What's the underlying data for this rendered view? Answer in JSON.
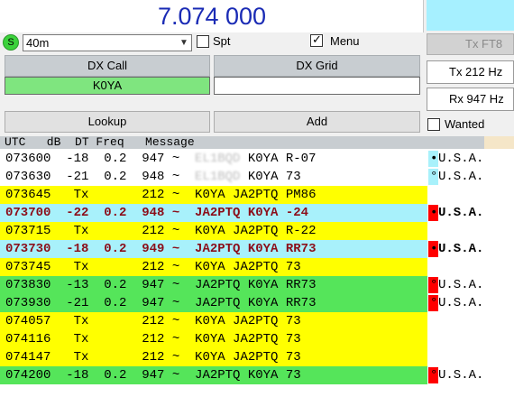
{
  "frequency": "7.074 000",
  "colors": {
    "cq_row": "#ffffff",
    "tx_row": "#ffff00",
    "to_me_row": "#ff0000",
    "reply_row": "#a8f1fb",
    "new_country_row": "#55e55a",
    "dx_call_field": "#7fe57f",
    "frequency_text": "#1a2bb5"
  },
  "controls": {
    "s_button": "S",
    "band": "40m",
    "spt_label": "Spt",
    "spt_checked": false,
    "menu_label": "Menu",
    "menu_checked": true,
    "tx_mode_button": "Tx FT8"
  },
  "dx": {
    "call_header": "DX Call",
    "call_value": "K0YA",
    "grid_header": "DX Grid",
    "grid_value": "",
    "lookup_label": "Lookup",
    "add_label": "Add"
  },
  "tx_rx": {
    "tx_text": "Tx  212  Hz",
    "rx_text": "Rx  947  Hz",
    "wanted_label": "Wanted",
    "wanted_checked": false
  },
  "columns_header": "UTC   dB  DT Freq   Message",
  "messages": [
    {
      "utc": "073600",
      "db": "-18",
      "dt": "0.2",
      "freq": "947",
      "sep": "~",
      "call_from": "EL1BQD",
      "call_from_blurred": true,
      "text": "K0YA R-07",
      "bg": "#ffffff",
      "bold": false,
      "mark_color": "#a8f1fb",
      "mark_symbol": "•",
      "country": "U.S.A."
    },
    {
      "utc": "073630",
      "db": "-21",
      "dt": "0.2",
      "freq": "948",
      "sep": "~",
      "call_from": "EL1BQD",
      "call_from_blurred": true,
      "text": "K0YA 73",
      "bg": "#ffffff",
      "bold": false,
      "mark_color": "#a8f1fb",
      "mark_symbol": "°",
      "country": "U.S.A."
    },
    {
      "utc": "073645",
      "db": "Tx",
      "dt": "",
      "freq": "212",
      "sep": "~",
      "call_from": "",
      "call_from_blurred": false,
      "text": "K0YA JA2PTQ PM86",
      "bg": "#ffff00",
      "bold": false,
      "mark_color": "",
      "mark_symbol": "",
      "country": ""
    },
    {
      "utc": "073700",
      "db": "-22",
      "dt": "0.2",
      "freq": "948",
      "sep": "~",
      "call_from": "",
      "call_from_blurred": false,
      "text": "JA2PTQ K0YA -24",
      "bg": "#a8f1fb",
      "bold": true,
      "mark_color": "#ff0000",
      "mark_symbol": "•",
      "country": "U.S.A."
    },
    {
      "utc": "073715",
      "db": "Tx",
      "dt": "",
      "freq": "212",
      "sep": "~",
      "call_from": "",
      "call_from_blurred": false,
      "text": "K0YA JA2PTQ R-22",
      "bg": "#ffff00",
      "bold": false,
      "mark_color": "",
      "mark_symbol": "",
      "country": ""
    },
    {
      "utc": "073730",
      "db": "-18",
      "dt": "0.2",
      "freq": "949",
      "sep": "~",
      "call_from": "",
      "call_from_blurred": false,
      "text": "JA2PTQ K0YA RR73",
      "bg": "#a8f1fb",
      "bold": true,
      "mark_color": "#ff0000",
      "mark_symbol": "•",
      "country": "U.S.A."
    },
    {
      "utc": "073745",
      "db": "Tx",
      "dt": "",
      "freq": "212",
      "sep": "~",
      "call_from": "",
      "call_from_blurred": false,
      "text": "K0YA JA2PTQ 73",
      "bg": "#ffff00",
      "bold": false,
      "mark_color": "",
      "mark_symbol": "",
      "country": ""
    },
    {
      "utc": "073830",
      "db": "-13",
      "dt": "0.2",
      "freq": "947",
      "sep": "~",
      "call_from": "",
      "call_from_blurred": false,
      "text": "JA2PTQ K0YA RR73",
      "bg": "#55e55a",
      "bold": false,
      "mark_color": "#ff0000",
      "mark_symbol": "°",
      "country": "U.S.A."
    },
    {
      "utc": "073930",
      "db": "-21",
      "dt": "0.2",
      "freq": "947",
      "sep": "~",
      "call_from": "",
      "call_from_blurred": false,
      "text": "JA2PTQ K0YA RR73",
      "bg": "#55e55a",
      "bold": false,
      "mark_color": "#ff0000",
      "mark_symbol": "°",
      "country": "U.S.A."
    },
    {
      "utc": "074057",
      "db": "Tx",
      "dt": "",
      "freq": "212",
      "sep": "~",
      "call_from": "",
      "call_from_blurred": false,
      "text": "K0YA JA2PTQ 73",
      "bg": "#ffff00",
      "bold": false,
      "mark_color": "",
      "mark_symbol": "",
      "country": ""
    },
    {
      "utc": "074116",
      "db": "Tx",
      "dt": "",
      "freq": "212",
      "sep": "~",
      "call_from": "",
      "call_from_blurred": false,
      "text": "K0YA JA2PTQ 73",
      "bg": "#ffff00",
      "bold": false,
      "mark_color": "",
      "mark_symbol": "",
      "country": ""
    },
    {
      "utc": "074147",
      "db": "Tx",
      "dt": "",
      "freq": "212",
      "sep": "~",
      "call_from": "",
      "call_from_blurred": false,
      "text": "K0YA JA2PTQ 73",
      "bg": "#ffff00",
      "bold": false,
      "mark_color": "",
      "mark_symbol": "",
      "country": ""
    },
    {
      "utc": "074200",
      "db": "-18",
      "dt": "0.2",
      "freq": "947",
      "sep": "~",
      "call_from": "",
      "call_from_blurred": false,
      "text": "JA2PTQ K0YA 73",
      "bg": "#55e55a",
      "bold": false,
      "mark_color": "#ff0000",
      "mark_symbol": "°",
      "country": "U.S.A."
    }
  ]
}
